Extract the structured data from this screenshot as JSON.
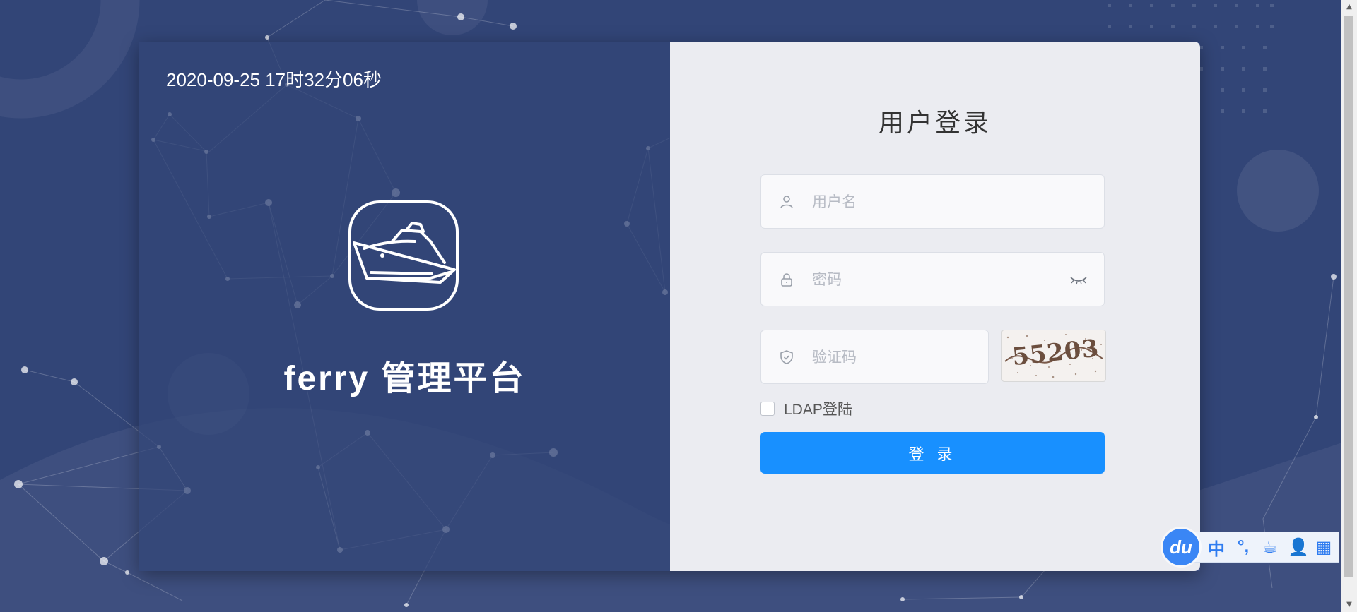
{
  "page": {
    "datetime": "2020-09-25 17时32分06秒",
    "brand": "ferry 管理平台"
  },
  "login": {
    "title": "用户登录",
    "username_placeholder": "用户名",
    "password_placeholder": "密码",
    "captcha_placeholder": "验证码",
    "captcha_image_text": "55203",
    "ldap_label": "LDAP登陆",
    "ldap_checked": false,
    "submit_label": "登 录"
  },
  "icons": {
    "logo": "ship-logo-icon",
    "username": "user-icon",
    "password": "lock-icon",
    "captcha": "shield-icon",
    "toggle_password": "eye-closed-icon"
  },
  "ime_toolbar": {
    "logo": "du",
    "items": [
      "中",
      "°,",
      "☕",
      "👤",
      "▦"
    ]
  },
  "colors": {
    "background": "#324577",
    "login_panel": "#ebecf1",
    "primary_button": "#1890ff"
  }
}
